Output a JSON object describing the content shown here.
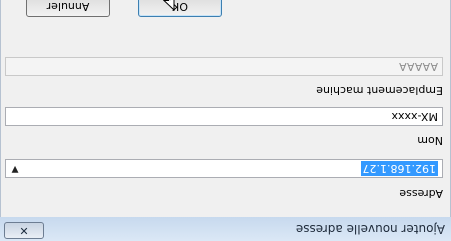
{
  "window": {
    "title": "Ajouter nouvelle adresse",
    "close_label": "✕"
  },
  "fields": {
    "address": {
      "label": "Adresse",
      "value": "192.168.1.27"
    },
    "name": {
      "label": "Nom",
      "value": "MX-xxxx"
    },
    "location": {
      "label": "Emplacement machine",
      "value": "AAAAA"
    }
  },
  "buttons": {
    "ok_label": "OK",
    "cancel_label": "Annuler"
  }
}
